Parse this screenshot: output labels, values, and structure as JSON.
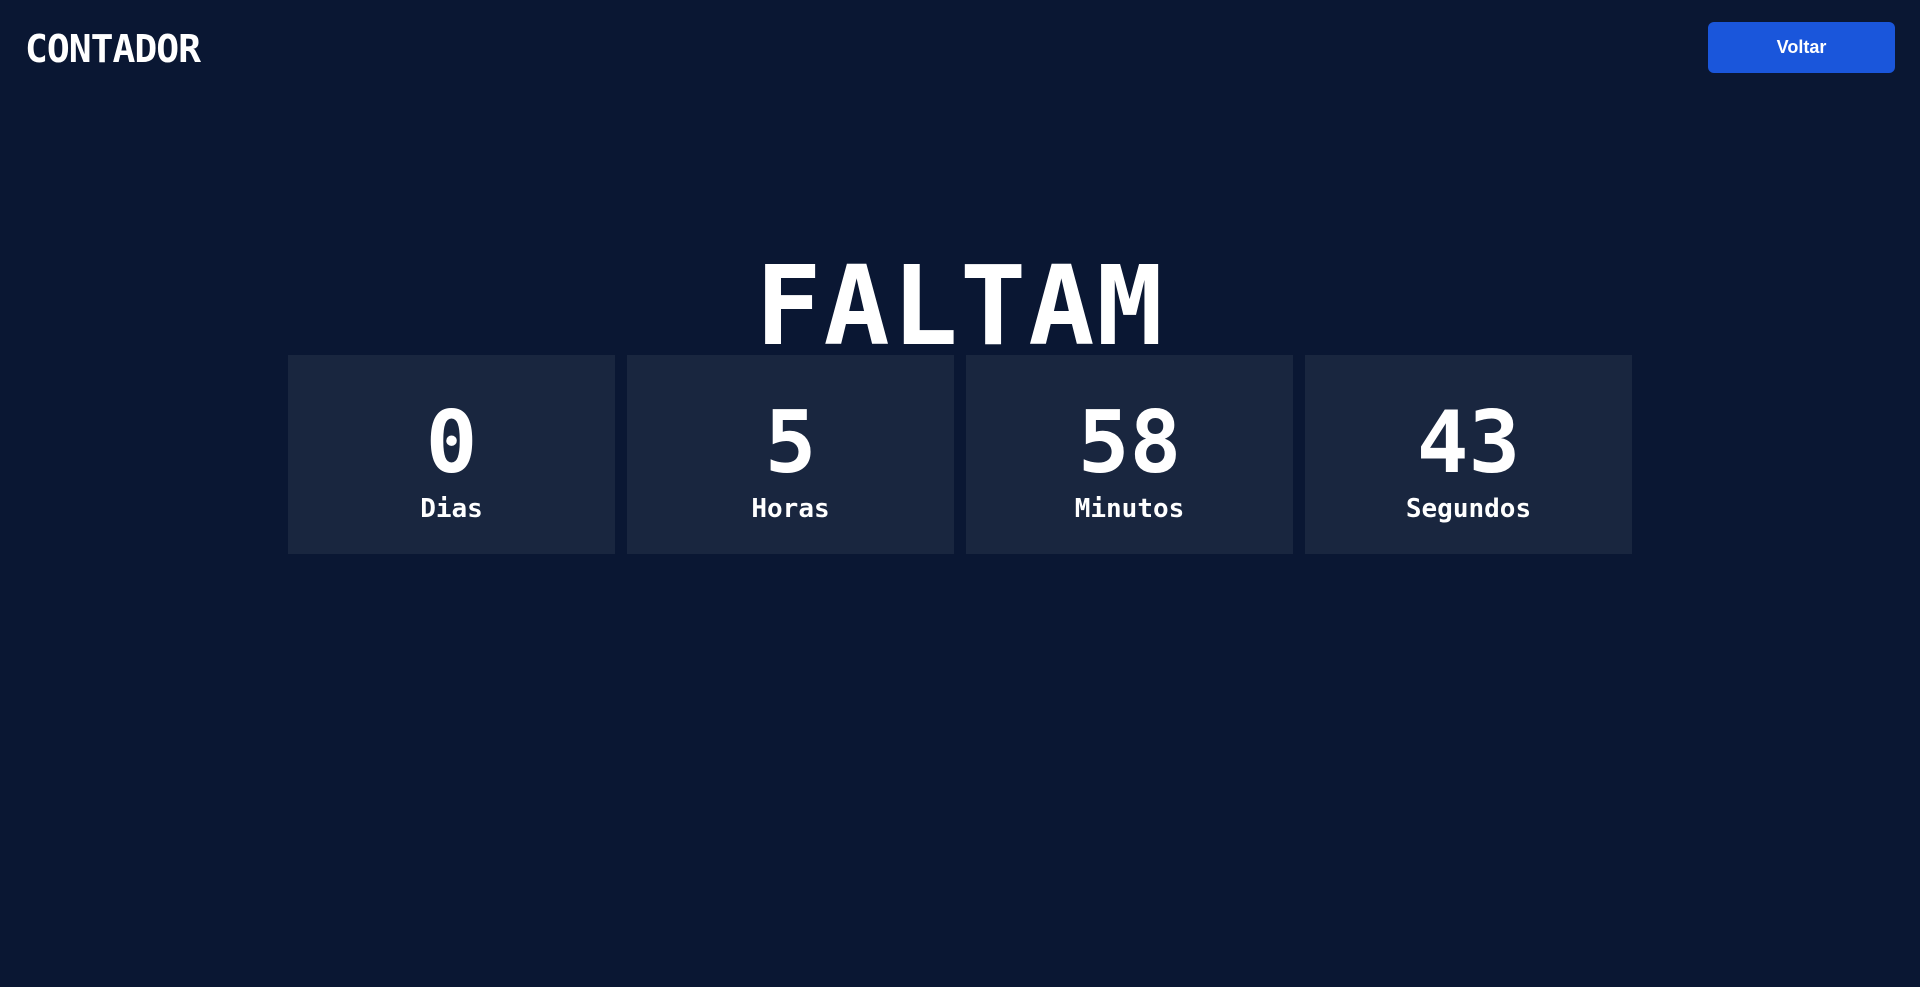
{
  "header": {
    "brand": "CONTADOR",
    "back_label": "Voltar"
  },
  "main": {
    "headline": "FALTAM",
    "units": [
      {
        "value": "0",
        "label": "Dias"
      },
      {
        "value": "5",
        "label": "Horas"
      },
      {
        "value": "58",
        "label": "Minutos"
      },
      {
        "value": "43",
        "label": "Segundos"
      }
    ]
  },
  "colors": {
    "background": "#0a1733",
    "card": "#19263f",
    "accent": "#1a56db",
    "text": "#ffffff"
  }
}
